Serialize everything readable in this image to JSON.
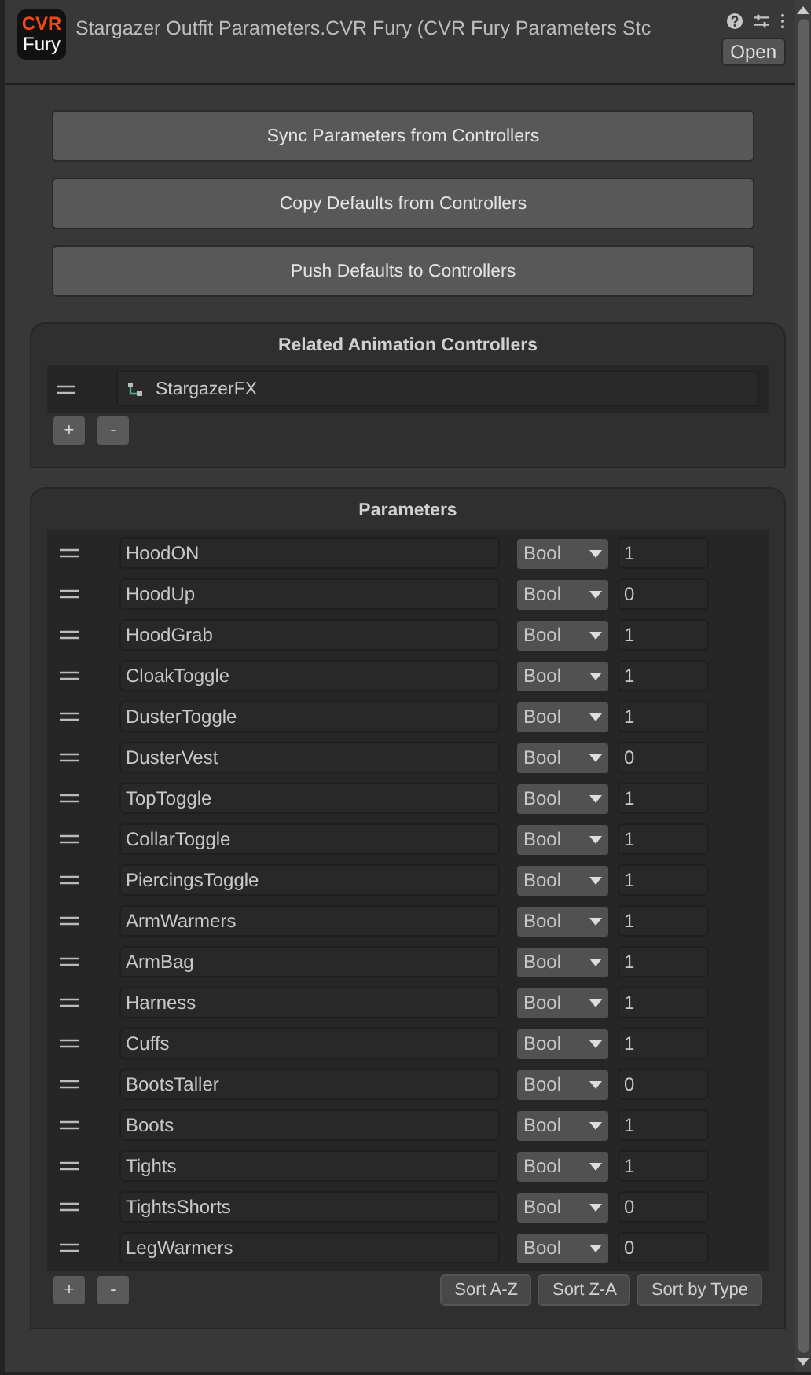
{
  "header": {
    "logo": [
      "CVR",
      "Fury"
    ],
    "title": "Stargazer Outfit Parameters.CVR Fury (CVR Fury Parameters Stc",
    "open_button": "Open"
  },
  "actions": [
    "Sync Parameters from Controllers",
    "Copy Defaults from Controllers",
    "Push Defaults to Controllers"
  ],
  "controllers": {
    "title": "Related Animation Controllers",
    "items": [
      "StargazerFX"
    ],
    "add": "+",
    "remove": "-"
  },
  "parameters": {
    "title": "Parameters",
    "rows": [
      {
        "name": "HoodON",
        "type": "Bool",
        "value": "1"
      },
      {
        "name": "HoodUp",
        "type": "Bool",
        "value": "0"
      },
      {
        "name": "HoodGrab",
        "type": "Bool",
        "value": "1"
      },
      {
        "name": "CloakToggle",
        "type": "Bool",
        "value": "1"
      },
      {
        "name": "DusterToggle",
        "type": "Bool",
        "value": "1"
      },
      {
        "name": "DusterVest",
        "type": "Bool",
        "value": "0"
      },
      {
        "name": "TopToggle",
        "type": "Bool",
        "value": "1"
      },
      {
        "name": "CollarToggle",
        "type": "Bool",
        "value": "1"
      },
      {
        "name": "PiercingsToggle",
        "type": "Bool",
        "value": "1"
      },
      {
        "name": "ArmWarmers",
        "type": "Bool",
        "value": "1"
      },
      {
        "name": "ArmBag",
        "type": "Bool",
        "value": "1"
      },
      {
        "name": "Harness",
        "type": "Bool",
        "value": "1"
      },
      {
        "name": "Cuffs",
        "type": "Bool",
        "value": "1"
      },
      {
        "name": "BootsTaller",
        "type": "Bool",
        "value": "0"
      },
      {
        "name": "Boots",
        "type": "Bool",
        "value": "1"
      },
      {
        "name": "Tights",
        "type": "Bool",
        "value": "1"
      },
      {
        "name": "TightsShorts",
        "type": "Bool",
        "value": "0"
      },
      {
        "name": "LegWarmers",
        "type": "Bool",
        "value": "0"
      }
    ],
    "add": "+",
    "remove": "-",
    "sort_buttons": [
      "Sort A-Z",
      "Sort Z-A",
      "Sort by Type"
    ]
  }
}
